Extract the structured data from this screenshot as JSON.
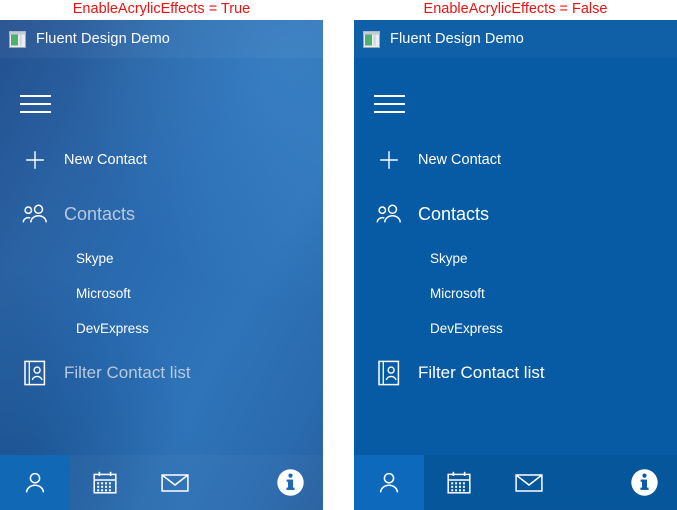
{
  "captions": {
    "left": "EnableAcrylicEffects = True",
    "right": "EnableAcrylicEffects = False",
    "color": "#ee1111"
  },
  "window": {
    "title": "Fluent Design Demo",
    "icon": "application-window-icon"
  },
  "colors": {
    "acrylic_panel_base": "#2a6cb2",
    "solid_panel": "#075ba4",
    "selected_tab_acrylic": "#1169b5",
    "selected_tab_solid": "#0d69bb",
    "text_primary": "#ffffff",
    "text_muted_acrylic": "#b8c9de"
  },
  "nav": {
    "hamburger_label": "hamburger-menu",
    "items": [
      {
        "label": "New Contact",
        "icon": "plus-icon"
      },
      {
        "label": "Contacts",
        "icon": "people-icon"
      }
    ],
    "sub_items": [
      {
        "label": "Skype"
      },
      {
        "label": "Microsoft"
      },
      {
        "label": "DevExpress"
      }
    ],
    "filter": {
      "label": "Filter Contact list",
      "icon": "contact-card-icon"
    }
  },
  "bottom_bar": {
    "tabs": [
      {
        "name": "person",
        "icon": "person-icon",
        "selected": true
      },
      {
        "name": "calendar",
        "icon": "calendar-icon",
        "selected": false
      },
      {
        "name": "mail",
        "icon": "mail-icon",
        "selected": false
      }
    ],
    "info_button": {
      "name": "info",
      "icon": "info-icon"
    }
  }
}
